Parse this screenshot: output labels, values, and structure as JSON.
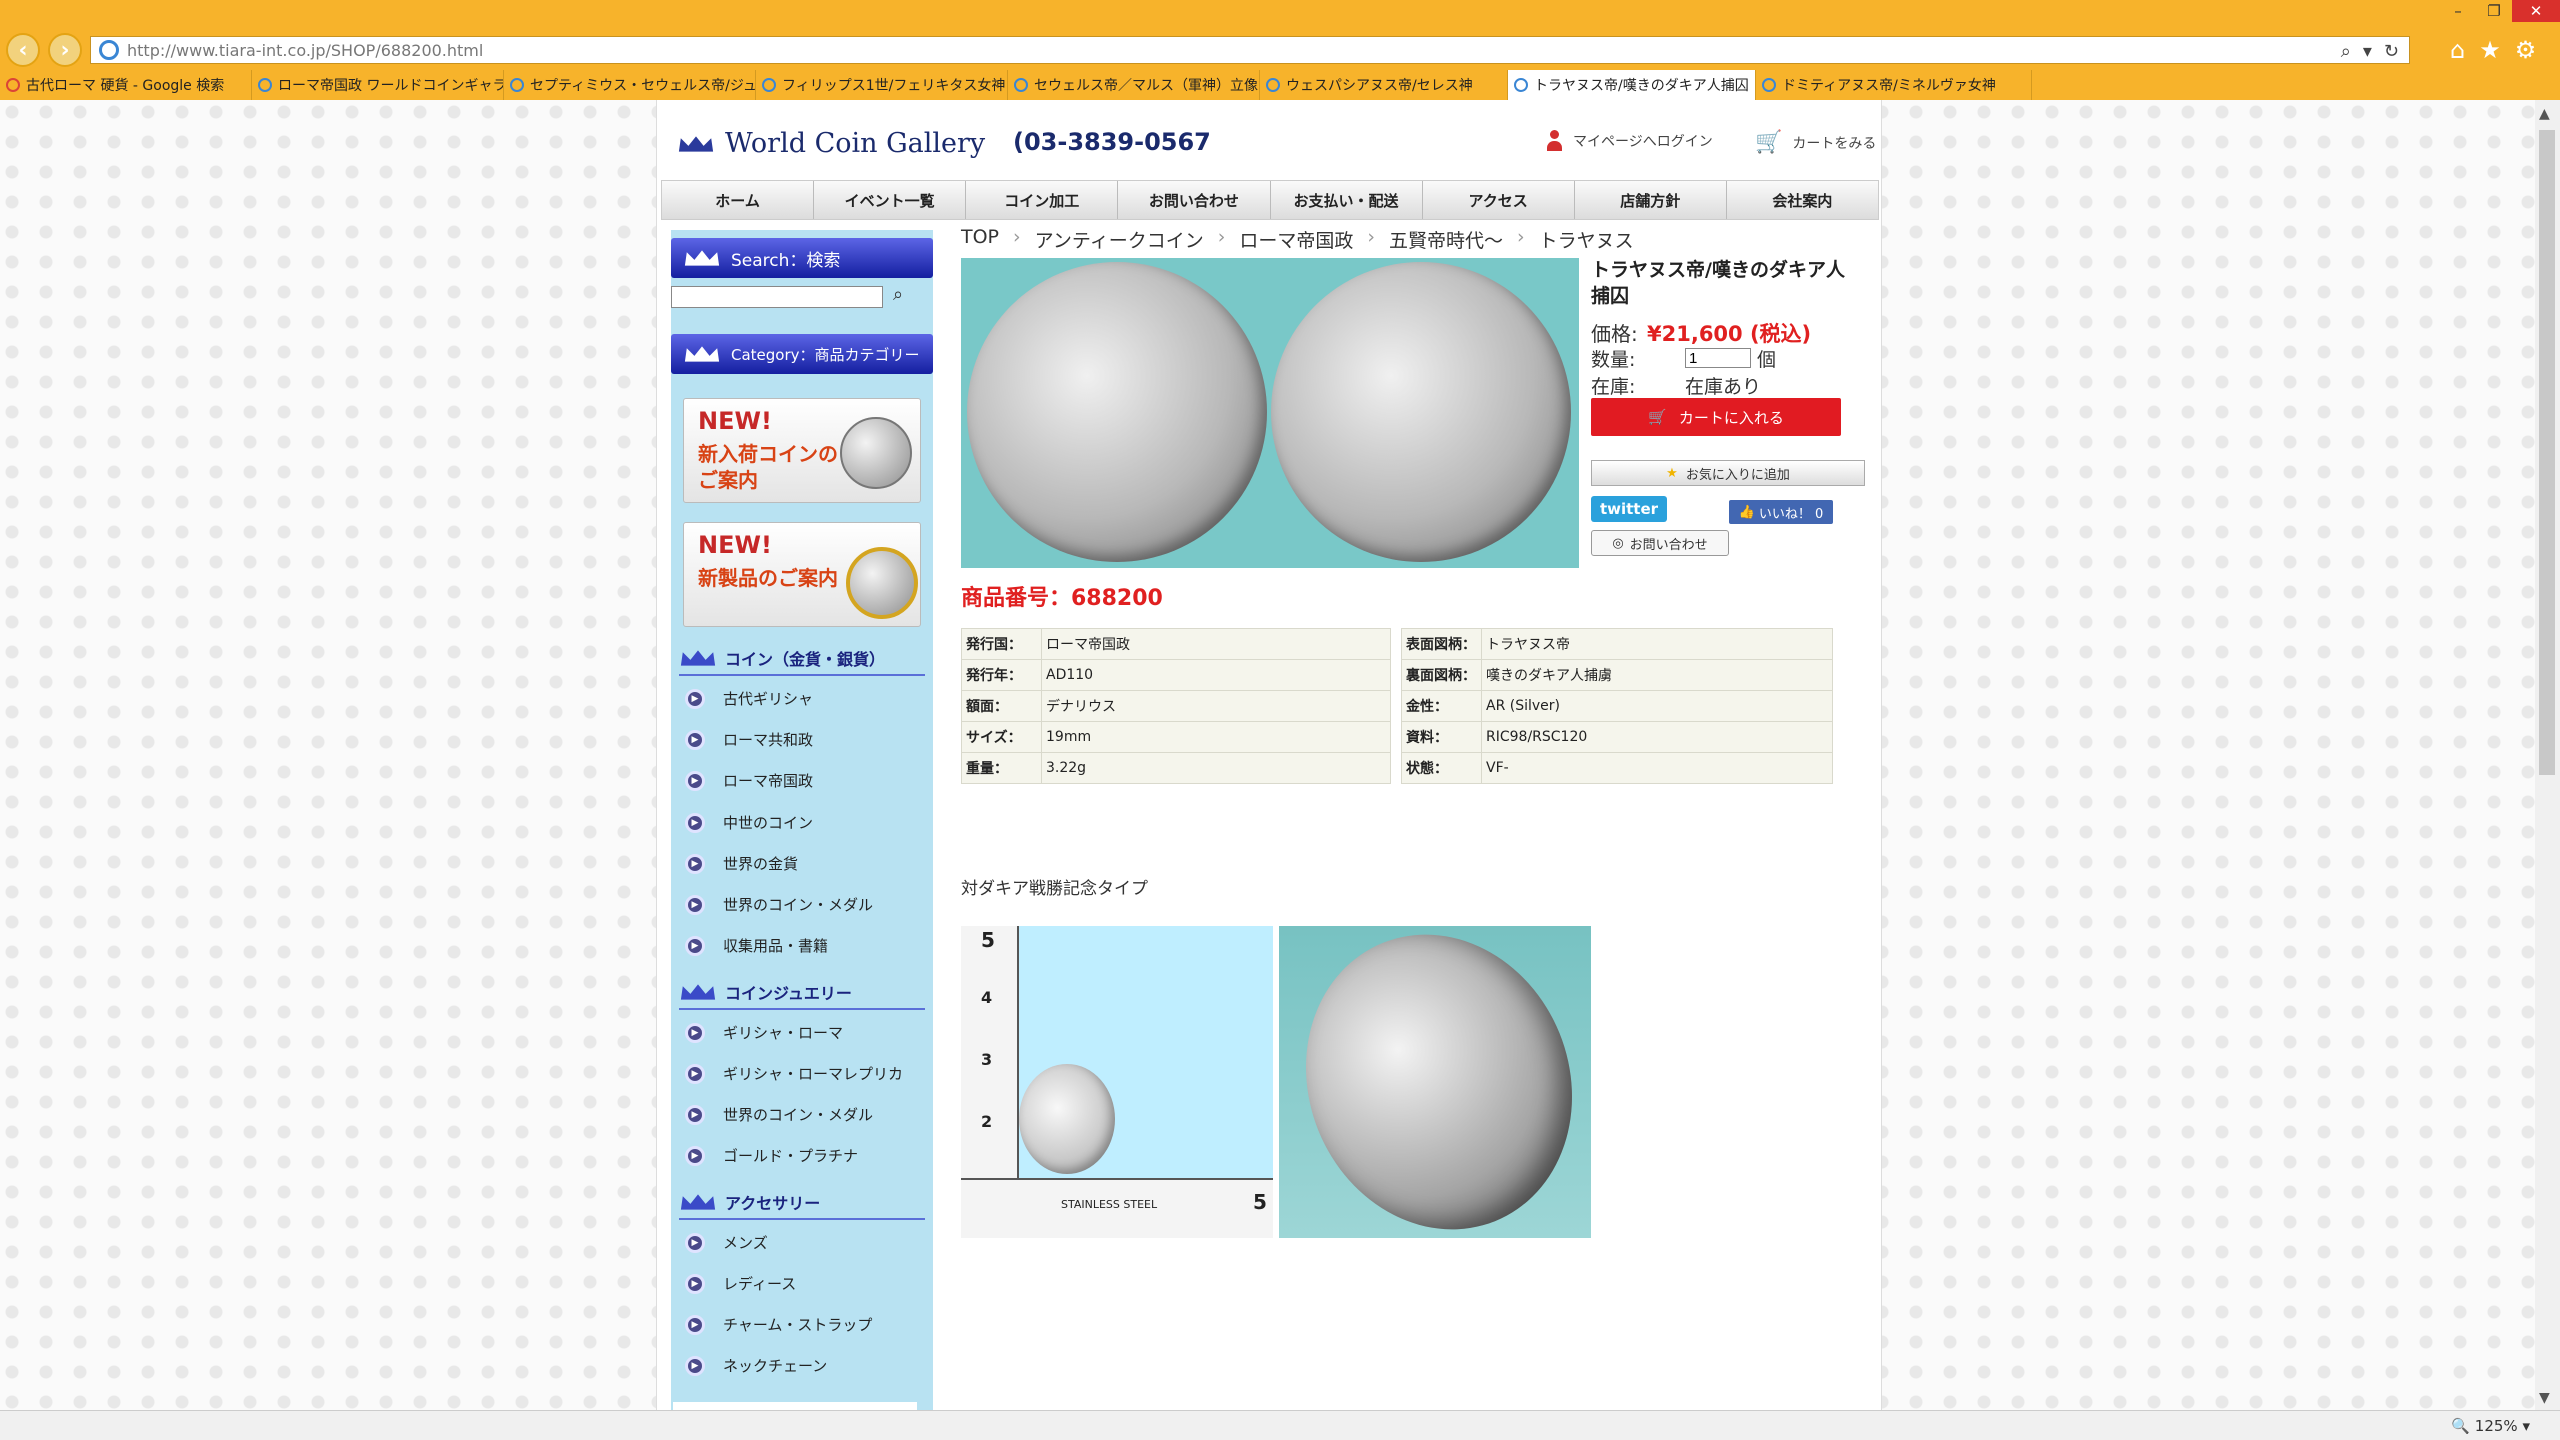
{
  "browser": {
    "url": "http://www.tiara-int.co.jp/SHOP/688200.html",
    "tabs": [
      {
        "label": "古代ローマ 硬貨 - Google 検索",
        "active": false
      },
      {
        "label": "ローマ帝国政 ワールドコインギャラ...",
        "active": false
      },
      {
        "label": "セプティミウス・セウェルス帝/ジュピ...",
        "active": false
      },
      {
        "label": "フィリップス1世/フェリキタス女神",
        "active": false
      },
      {
        "label": "セウェルス帝／マルス（軍神）立像",
        "active": false
      },
      {
        "label": "ウェスパシアヌス帝/セレス神",
        "active": false
      },
      {
        "label": "トラヤヌス帝/嘆きのダキア人捕囚",
        "active": true
      },
      {
        "label": "ドミティアヌス帝/ミネルヴァ女神",
        "active": false
      }
    ],
    "zoom": "125%"
  },
  "site": {
    "logo_text": "World Coin Gallery",
    "phone": "03-3839-0567",
    "mypage": "マイページへログイン",
    "cart": "カートをみる",
    "nav": [
      "ホーム",
      "イベント一覧",
      "コイン加工",
      "お問い合わせ",
      "お支払い・配送",
      "アクセス",
      "店舗方針",
      "会社案内"
    ]
  },
  "sidebar": {
    "search_head": "Search：検索",
    "category_head": "Category：商品カテゴリー",
    "banner1": {
      "new": "NEW!",
      "line1": "新入荷コインの",
      "line2": "ご案内"
    },
    "banner2": {
      "new": "NEW!",
      "line1": "新製品のご案内"
    },
    "sections": [
      {
        "title": "コイン（金貨・銀貨）",
        "items": [
          "古代ギリシャ",
          "ローマ共和政",
          "ローマ帝国政",
          "中世のコイン",
          "世界の金貨",
          "世界のコイン・メダル",
          "収集用品・書籍"
        ]
      },
      {
        "title": "コインジュエリー",
        "items": [
          "ギリシャ・ローマ",
          "ギリシャ・ローマレプリカ",
          "世界のコイン・メダル",
          "ゴールド・プラチナ"
        ]
      },
      {
        "title": "アクセサリー",
        "items": [
          "メンズ",
          "レディース",
          "チャーム・ストラップ",
          "ネックチェーン"
        ]
      }
    ]
  },
  "breadcrumb": [
    "TOP",
    "アンティークコイン",
    "ローマ帝国政",
    "五賢帝時代〜",
    "トラヤヌス"
  ],
  "product": {
    "title": "トラヤヌス帝/嘆きのダキア人捕囚",
    "price_label": "価格:",
    "price": "¥21,600 (税込)",
    "qty_label": "数量:",
    "qty": "1",
    "qty_unit": "個",
    "stock_label": "在庫:",
    "stock": "在庫あり",
    "cart_button": "カートに入れる",
    "fav_button": "お気に入りに追加",
    "twitter": "twitter",
    "like": "いいね！ 0",
    "inquiry": "お問い合わせ",
    "item_no": "商品番号：688200",
    "specs_left": [
      {
        "k": "発行国：",
        "v": "ローマ帝国政"
      },
      {
        "k": "発行年：",
        "v": "AD110"
      },
      {
        "k": "額面：",
        "v": "デナリウス"
      },
      {
        "k": "サイズ：",
        "v": "19mm"
      },
      {
        "k": "重量：",
        "v": "3.22g"
      }
    ],
    "specs_right": [
      {
        "k": "表面図柄：",
        "v": "トラヤヌス帝"
      },
      {
        "k": "裏面図柄：",
        "v": "嘆きのダキア人捕虜"
      },
      {
        "k": "金性：",
        "v": "AR (Silver)"
      },
      {
        "k": "資料：",
        "v": "RIC98/RSC120"
      },
      {
        "k": "状態：",
        "v": "VF-"
      }
    ],
    "description": "対ダキア戦勝記念タイプ",
    "ruler_label": "STAINLESS STEEL"
  },
  "colors": {
    "accent_red": "#e11b22",
    "nav_blue": "#1a237e",
    "sidebar_bg": "#b8e2f2",
    "chrome": "#f7b32b"
  }
}
